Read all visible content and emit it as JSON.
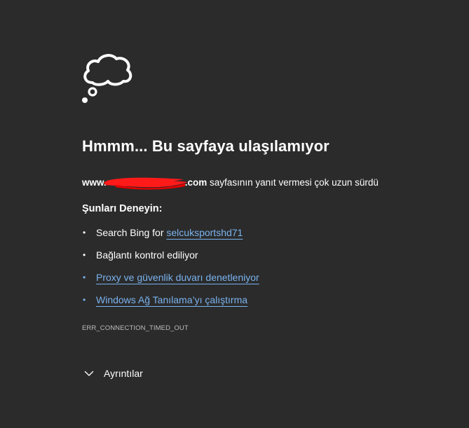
{
  "error_page": {
    "icon": "cloud-thought-icon",
    "title": "Hmmm... Bu sayfaya ulaşılamıyor",
    "url_prefix": "www.",
    "url_suffix": ".com",
    "message": "sayfasının yanıt vermesi çok uzun sürdü",
    "try_heading": "Şunları Deneyin:",
    "suggestions": [
      {
        "prefix": "Search Bing for ",
        "link": "selcuksportshd71"
      },
      {
        "text": "Bağlantı kontrol ediliyor"
      },
      {
        "link": "Proxy ve güvenlik duvarı denetleniyor"
      },
      {
        "link": "Windows Ağ Tanılama’yı çalıştırma"
      }
    ],
    "error_code": "ERR_CONNECTION_TIMED_OUT",
    "details_label": "Ayrıntılar",
    "details_icon": "chevron-down-icon",
    "colors": {
      "background": "#2b2b2b",
      "text": "#ffffff",
      "link": "#7ab3ef",
      "redaction": "#ff1a1a"
    }
  }
}
